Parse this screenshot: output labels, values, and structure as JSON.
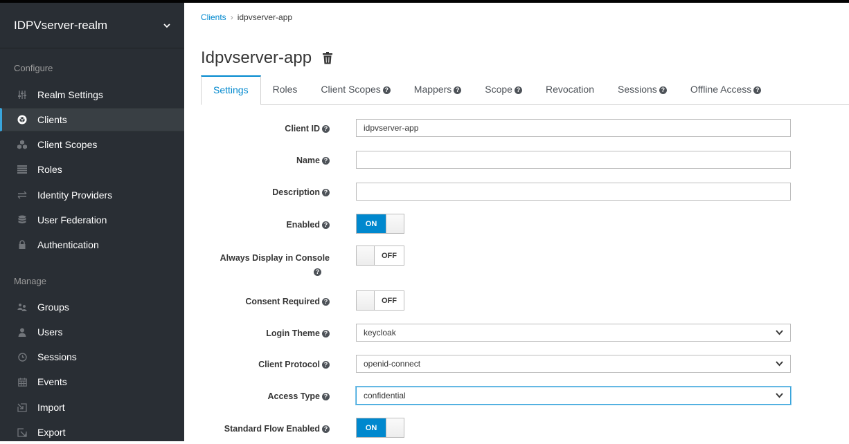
{
  "sidebar": {
    "realm": "IDPVserver-realm",
    "configure_label": "Configure",
    "manage_label": "Manage",
    "configure_items": [
      {
        "label": "Realm Settings",
        "icon": "sliders-icon"
      },
      {
        "label": "Clients",
        "icon": "cube-icon",
        "active": true
      },
      {
        "label": "Client Scopes",
        "icon": "cubes-icon"
      },
      {
        "label": "Roles",
        "icon": "list-icon"
      },
      {
        "label": "Identity Providers",
        "icon": "exchange-icon"
      },
      {
        "label": "User Federation",
        "icon": "database-icon"
      },
      {
        "label": "Authentication",
        "icon": "lock-icon"
      }
    ],
    "manage_items": [
      {
        "label": "Groups",
        "icon": "users-icon"
      },
      {
        "label": "Users",
        "icon": "user-icon"
      },
      {
        "label": "Sessions",
        "icon": "clock-icon"
      },
      {
        "label": "Events",
        "icon": "calendar-icon"
      },
      {
        "label": "Import",
        "icon": "import-icon"
      },
      {
        "label": "Export",
        "icon": "export-icon"
      }
    ]
  },
  "breadcrumb": {
    "parent": "Clients",
    "sep": "›",
    "current": "idpvserver-app"
  },
  "page_title": "Idpvserver-app",
  "tabs": [
    "Settings",
    "Roles",
    "Client Scopes",
    "Mappers",
    "Scope",
    "Revocation",
    "Sessions",
    "Offline Access"
  ],
  "form": {
    "client_id_label": "Client ID",
    "client_id_value": "idpvserver-app",
    "name_label": "Name",
    "name_value": "",
    "description_label": "Description",
    "description_value": "",
    "enabled_label": "Enabled",
    "enabled_value": "ON",
    "always_display_label": "Always Display in Console",
    "always_display_value": "OFF",
    "consent_label": "Consent Required",
    "consent_value": "OFF",
    "login_theme_label": "Login Theme",
    "login_theme_value": "keycloak",
    "client_protocol_label": "Client Protocol",
    "client_protocol_value": "openid-connect",
    "access_type_label": "Access Type",
    "access_type_value": "confidential",
    "standard_flow_label": "Standard Flow Enabled",
    "standard_flow_value": "ON"
  },
  "colors": {
    "accent": "#0088ce",
    "sidebar_bg": "#292e34",
    "active_bar": "#39a5dc"
  }
}
